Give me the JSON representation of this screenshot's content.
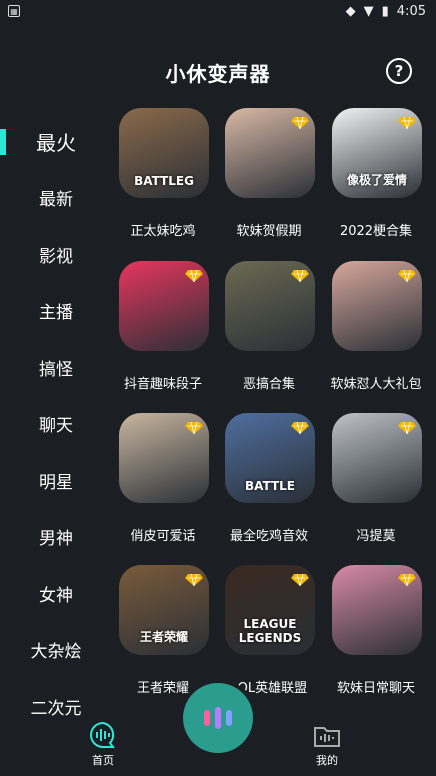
{
  "status": {
    "time": "4:05"
  },
  "header": {
    "title": "小休变声器",
    "help_icon": "?"
  },
  "sidebar": {
    "items": [
      {
        "label": "最火",
        "active": true
      },
      {
        "label": "最新"
      },
      {
        "label": "影视"
      },
      {
        "label": "主播"
      },
      {
        "label": "搞怪"
      },
      {
        "label": "聊天"
      },
      {
        "label": "明星"
      },
      {
        "label": "男神"
      },
      {
        "label": "女神"
      },
      {
        "label": "大杂烩"
      },
      {
        "label": "二次元"
      }
    ]
  },
  "cards": [
    {
      "label": "正太妹吃鸡",
      "color": "#8b6a4a",
      "badge": false,
      "thumb_text": "BATTLEG"
    },
    {
      "label": "软妹贺假期",
      "color": "#d9b9a6",
      "badge": true
    },
    {
      "label": "2022梗合集",
      "color": "#f2f2f2",
      "badge": true,
      "thumb_text": "像极了爱情"
    },
    {
      "label": "抖音趣味段子",
      "color": "#e8365d",
      "badge": true
    },
    {
      "label": "恶搞合集",
      "color": "#6b6a52",
      "badge": true
    },
    {
      "label": "软妹怼人大礼包",
      "color": "#d7a89c",
      "badge": true
    },
    {
      "label": "俏皮可爱话",
      "color": "#c9b7a0",
      "badge": true
    },
    {
      "label": "最全吃鸡音效",
      "color": "#4f6fa0",
      "badge": true,
      "thumb_text": "BATTLE"
    },
    {
      "label": "冯提莫",
      "color": "#bfc3c9",
      "badge": true
    },
    {
      "label": "王者荣耀",
      "color": "#7a5b3a",
      "badge": true,
      "thumb_text": "王者荣耀"
    },
    {
      "label": "LOL英雄联盟",
      "color": "#3a2a20",
      "badge": true,
      "thumb_text": "LEAGUE LEGENDS"
    },
    {
      "label": "软妹日常聊天",
      "color": "#d98aa5",
      "badge": true
    }
  ],
  "tabbar": {
    "home_label": "首页",
    "mine_label": "我的"
  }
}
